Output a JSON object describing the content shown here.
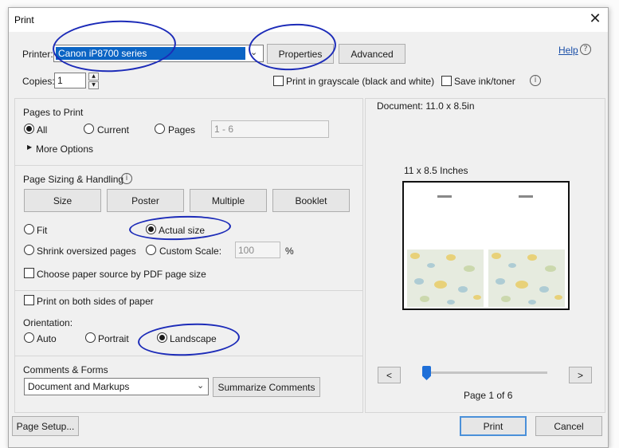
{
  "dialog": {
    "title": "Print",
    "close_icon": "close-icon"
  },
  "printer": {
    "label": "Printer:",
    "selected": "Canon iP8700 series",
    "properties_label": "Properties",
    "advanced_label": "Advanced",
    "help_label": "Help",
    "help_icon": "?"
  },
  "copies": {
    "label": "Copies:",
    "value": "1",
    "grayscale_label": "Print in grayscale (black and white)",
    "save_ink_label": "Save ink/toner",
    "info_icon": "i"
  },
  "pages_to_print": {
    "title": "Pages to Print",
    "all_label": "All",
    "current_label": "Current",
    "pages_label": "Pages",
    "pages_value": "1 - 6",
    "more_options_label": "More Options",
    "selected": "All"
  },
  "page_sizing": {
    "title": "Page Sizing & Handling",
    "info_icon": "i",
    "size_btn": "Size",
    "poster_btn": "Poster",
    "multiple_btn": "Multiple",
    "booklet_btn": "Booklet",
    "fit_label": "Fit",
    "actual_size_label": "Actual size",
    "shrink_label": "Shrink oversized pages",
    "custom_scale_label": "Custom Scale:",
    "custom_scale_value": "100",
    "percent": "%",
    "paper_source_label": "Choose paper source by PDF page size",
    "selected": "Actual size"
  },
  "duplex": {
    "both_sides_label": "Print on both sides of paper",
    "orientation_label": "Orientation:",
    "auto_label": "Auto",
    "portrait_label": "Portrait",
    "landscape_label": "Landscape",
    "selected": "Landscape"
  },
  "comments_forms": {
    "title": "Comments & Forms",
    "selected": "Document and Markups",
    "summarize_label": "Summarize Comments"
  },
  "preview": {
    "document_size": "Document: 11.0 x 8.5in",
    "paper_size": "11 x 8.5 Inches",
    "page_counter": "Page 1 of 6",
    "prev_label": "<",
    "next_label": ">",
    "slider_position": 0.0
  },
  "footer": {
    "page_setup_label": "Page Setup...",
    "print_label": "Print",
    "cancel_label": "Cancel"
  },
  "colors": {
    "dialog_bg": "#f0f0f0",
    "selection_blue": "#0b64c4",
    "link_blue": "#1a4fa8",
    "ink_annotation": "#1c2bb8"
  }
}
